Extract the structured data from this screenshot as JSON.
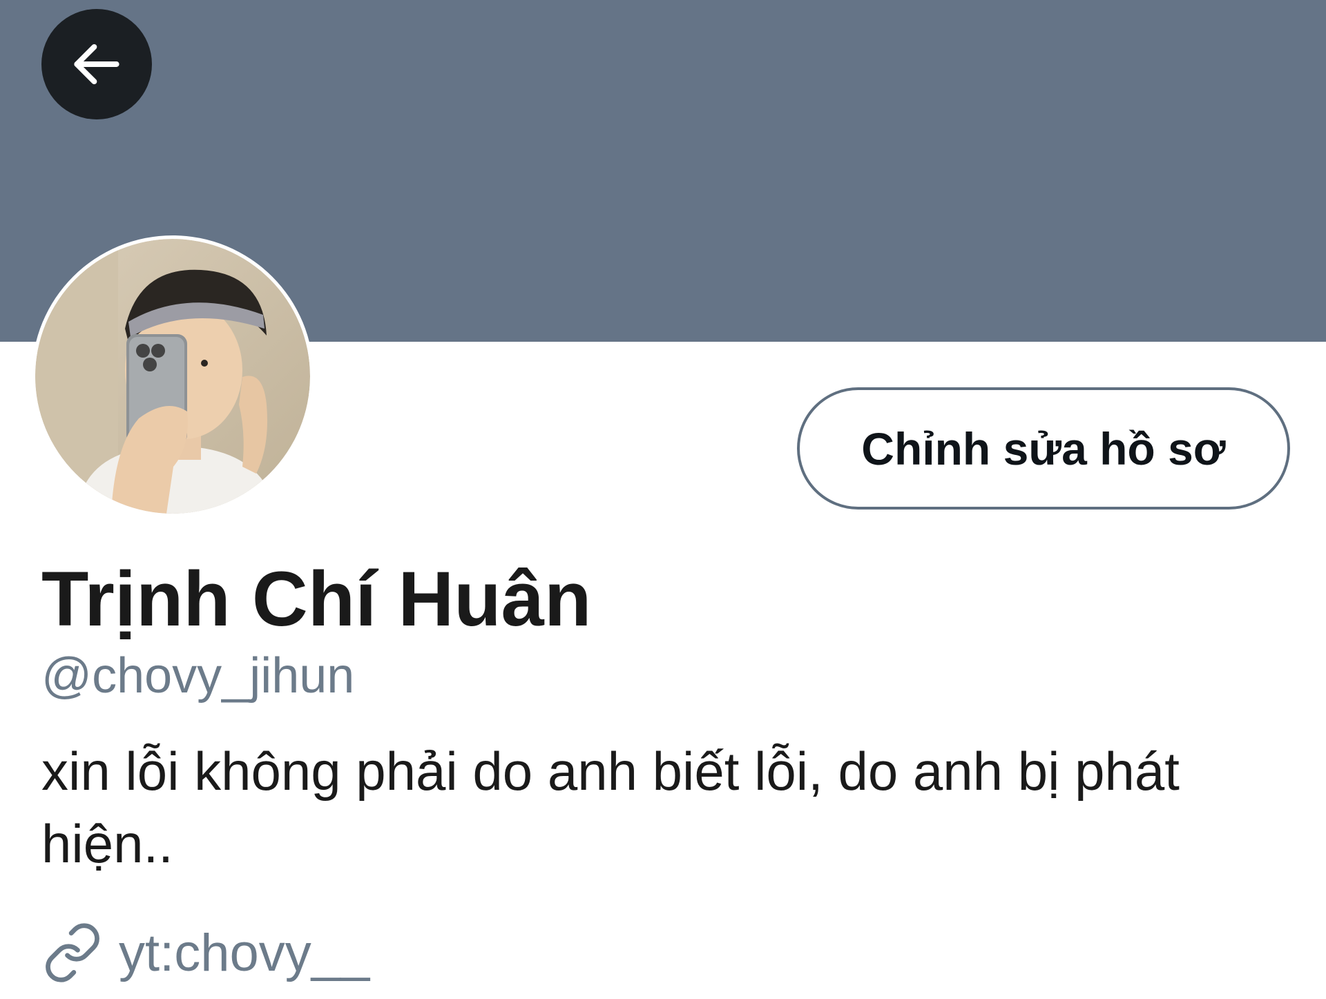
{
  "header": {
    "banner_color": "#657487",
    "back_icon": "arrow-left-icon"
  },
  "profile": {
    "avatar_alt": "profile photo",
    "edit_button_label": "Chỉnh sửa hồ sơ",
    "display_name": "Trịnh Chí Huân",
    "handle": "@chovy_jihun",
    "bio": "xin lỗi không phải do anh biết lỗi, do anh bị phát hiện..",
    "link_icon": "link-icon",
    "link_text": "yt:chovy__"
  },
  "colors": {
    "text_primary": "#1a1a1a",
    "text_secondary": "#6c7b8a",
    "button_border": "#5f6f80"
  }
}
